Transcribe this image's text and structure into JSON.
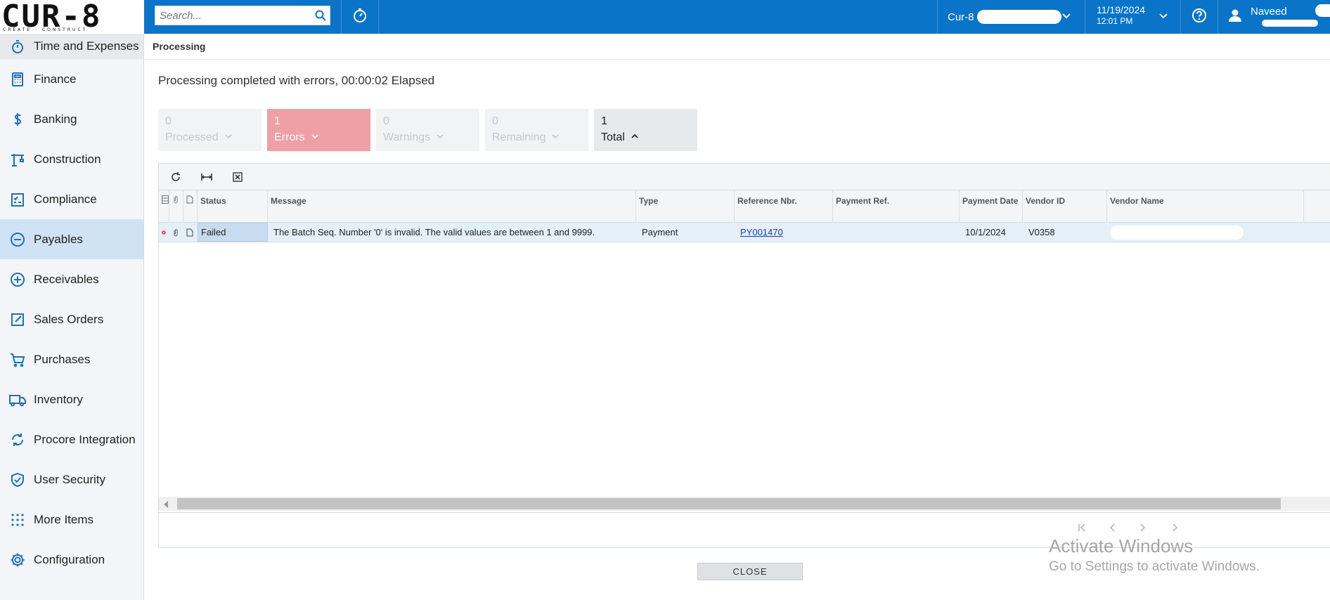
{
  "app": {
    "logo_text": "CUR-8",
    "logo_tagline": "CREATE · CONSTRUCT"
  },
  "topbar": {
    "search_placeholder": "Search...",
    "company": "Cur-8",
    "date": "11/19/2024",
    "time": "12:01 PM",
    "user_name": "Naveed"
  },
  "sidebar": {
    "items": [
      {
        "label": "Time and Expenses",
        "icon": "stopwatch-icon"
      },
      {
        "label": "Finance",
        "icon": "calculator-icon"
      },
      {
        "label": "Banking",
        "icon": "dollar-icon"
      },
      {
        "label": "Construction",
        "icon": "crane-icon"
      },
      {
        "label": "Compliance",
        "icon": "checklist-icon"
      },
      {
        "label": "Payables",
        "icon": "minus-circle-icon"
      },
      {
        "label": "Receivables",
        "icon": "plus-circle-icon"
      },
      {
        "label": "Sales Orders",
        "icon": "pencil-square-icon"
      },
      {
        "label": "Purchases",
        "icon": "cart-icon"
      },
      {
        "label": "Inventory",
        "icon": "truck-icon"
      },
      {
        "label": "Procore Integration",
        "icon": "sync-icon"
      },
      {
        "label": "User Security",
        "icon": "shield-icon"
      },
      {
        "label": "More Items",
        "icon": "grid-dots-icon"
      },
      {
        "label": "Configuration",
        "icon": "gear-icon"
      }
    ],
    "active": "Payables"
  },
  "main": {
    "breadcrumb": "Processing",
    "status_text": "Processing completed with errors, 00:00:02 Elapsed",
    "tiles": [
      {
        "count": "0",
        "label": "Processed"
      },
      {
        "count": "1",
        "label": "Errors"
      },
      {
        "count": "0",
        "label": "Warnings"
      },
      {
        "count": "0",
        "label": "Remaining"
      },
      {
        "count": "1",
        "label": "Total"
      }
    ],
    "grid": {
      "headers": [
        "Status",
        "Message",
        "Type",
        "Reference Nbr.",
        "Payment Ref.",
        "Payment Date",
        "Vendor ID",
        "Vendor Name"
      ],
      "rows": [
        {
          "status": "Failed",
          "message": "The Batch Seq. Number '0' is invalid. The valid values are between 1 and 9999.",
          "type": "Payment",
          "reference_nbr": "PY001470",
          "payment_ref": "",
          "payment_date": "10/1/2024",
          "vendor_id": "V0358",
          "vendor_name": ""
        }
      ]
    },
    "close_label": "CLOSE"
  },
  "watermark": {
    "line1": "Activate Windows",
    "line2": "Go to Settings to activate Windows."
  },
  "colors": {
    "topbar": "#0a74c9",
    "error_tile": "#ef9fa6",
    "active_nav": "#cfe3f5",
    "icon_blue": "#1a72bf"
  }
}
